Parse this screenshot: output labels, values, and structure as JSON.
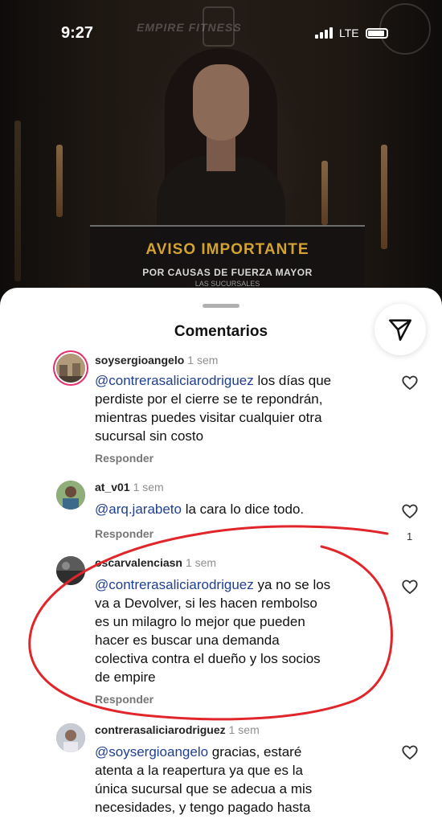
{
  "status_bar": {
    "time": "9:27",
    "network": "LTE"
  },
  "post": {
    "brand": "EMPIRE   FITNESS",
    "notice_title": "AVISO IMPORTANTE",
    "notice_subtitle": "POR CAUSAS DE FUERZA MAYOR",
    "notice_small": "LAS SUCURSALES"
  },
  "sheet": {
    "title": "Comentarios"
  },
  "comments": [
    {
      "username": "soysergioangelo",
      "time": "1 sem",
      "mention": "@contrerasaliciarodriguez",
      "text_line1": " los días que",
      "text_rest": [
        "perdiste por el cierre se te repondrán,",
        "mientras puedes visitar cualquier otra",
        "sucursal sin costo"
      ],
      "reply": "Responder"
    },
    {
      "username": "at_v01",
      "time": "1 sem",
      "mention": "@arq.jarabeto",
      "text_line1": " la cara lo dice todo.",
      "text_rest": [],
      "reply": "Responder",
      "likes": "1"
    },
    {
      "username": "oscarvalenciasn",
      "time": "1 sem",
      "mention": "@contrerasaliciarodriguez",
      "text_line1": " ya no se los",
      "text_rest": [
        "va a Devolver, si les hacen rembolso",
        "es un milagro lo mejor que pueden",
        "hacer es buscar una demanda",
        "colectiva contra el dueño y los socios",
        "de empire"
      ],
      "reply": "Responder"
    },
    {
      "username": "contrerasaliciarodriguez",
      "time": "1 sem",
      "mention": "@soysergioangelo",
      "text_line1": " gracias, estaré",
      "text_rest": [
        "atenta a la reapertura ya que es la",
        "única sucursal que se adecua a mis",
        "necesidades, y tengo pagado hasta"
      ],
      "reply": ""
    }
  ],
  "colors": {
    "mention": "#1f3f8f",
    "annotation": "#e0262b",
    "notice_title": "#d3a332"
  },
  "icons": [
    "share-icon",
    "heart-icon",
    "signal-icon",
    "battery-icon"
  ]
}
